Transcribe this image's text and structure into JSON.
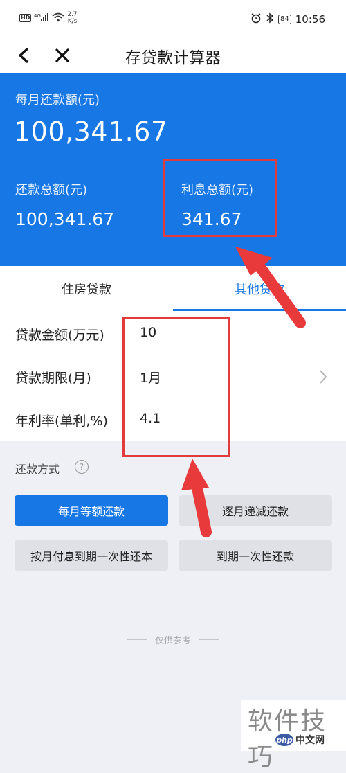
{
  "status_bar": {
    "hd": "HD",
    "signal": "4G",
    "speed_value": "2.7",
    "speed_unit": "K/s",
    "battery": "84",
    "time": "10:56"
  },
  "header": {
    "title": "存贷款计算器"
  },
  "summary": {
    "monthly_label": "每月还款额(元)",
    "monthly_value": "100,341.67",
    "total_label": "还款总额(元)",
    "total_value": "100,341.67",
    "interest_label": "利息总额(元)",
    "interest_value": "341.67"
  },
  "tabs": [
    {
      "label": "住房贷款",
      "active": false
    },
    {
      "label": "其他贷款",
      "active": true
    }
  ],
  "form": {
    "rows": [
      {
        "label": "贷款金额(万元)",
        "value": "10"
      },
      {
        "label": "贷款期限(月)",
        "value": "1月"
      },
      {
        "label": "年利率(单利,%)",
        "value": "4.1"
      }
    ]
  },
  "payment": {
    "label": "还款方式",
    "help": "?",
    "options": [
      {
        "label": "每月等额还款",
        "active": true
      },
      {
        "label": "逐月递减还款",
        "active": false
      },
      {
        "label": "按月付息到期一次性还本",
        "active": false
      },
      {
        "label": "到期一次性还款",
        "active": false
      }
    ]
  },
  "footer_note": "仅供参考",
  "watermark": {
    "text": "软件技巧",
    "badge_php": "php",
    "badge_cn": "中文网"
  },
  "colors": {
    "accent": "#1677e5",
    "annotation": "#e23b3b",
    "background": "#eff0f5"
  }
}
